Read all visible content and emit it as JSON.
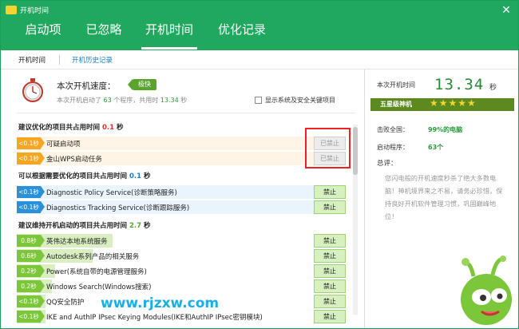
{
  "window": {
    "title": "开机时间",
    "close": "✕"
  },
  "tabs": [
    "启动项",
    "已忽略",
    "开机时间",
    "优化记录"
  ],
  "subnav": {
    "current": "开机时间",
    "history": "开机历史记录"
  },
  "speed": {
    "label": "本次开机速度：",
    "badge": "极快",
    "detail_pre": "本次开机启动了",
    "program_count": "63",
    "detail_mid": "个程序，共用时",
    "time": "13.34",
    "detail_post": "秒"
  },
  "show_system": {
    "label": "显示系统及安全关键项目"
  },
  "sections": [
    {
      "title": "建议优化的项目共占用时间",
      "value": "0.1",
      "unit": "秒"
    },
    {
      "title": "可以根据需要优化的项目共占用时间",
      "value": "0.1",
      "unit": "秒"
    },
    {
      "title": "建议维持开机启动的项目共占用时间",
      "value": "2.7",
      "unit": "秒"
    }
  ],
  "rows_optimize": [
    {
      "badge": "<0.1秒",
      "name": "可疑启动项",
      "button": "已禁止"
    },
    {
      "badge": "<0.1秒",
      "name": "金山WPS启动任务",
      "button": "已禁止"
    }
  ],
  "rows_optional": [
    {
      "badge": "<0.1秒",
      "name": "Diagnostic Policy Service(诊断策略服务)",
      "button": "禁止"
    },
    {
      "badge": "<0.1秒",
      "name": "Diagnostics Tracking Service(诊断跟踪服务)",
      "button": "禁止"
    }
  ],
  "rows_keep": [
    {
      "badge": "0.8秒",
      "name": "英伟达本地系统服务",
      "button": "禁止"
    },
    {
      "badge": "0.6秒",
      "name": "Autodesk系列产品的相关服务",
      "button": "禁止"
    },
    {
      "badge": "0.2秒",
      "name": "Power(系统自带的电源管理服务)",
      "button": "禁止"
    },
    {
      "badge": "0.2秒",
      "name": "Windows Search(Windows搜索)",
      "button": "禁止"
    },
    {
      "badge": "<0.1秒",
      "name": "QQ安全防护",
      "button": "禁止"
    },
    {
      "badge": "<0.1秒",
      "name": "IKE and AuthIP IPsec Keying Modules(IKE和AuthIP IPsec密钥模块)",
      "button": "禁止"
    }
  ],
  "right": {
    "boot_time_label": "本次开机时间",
    "boot_time": "13.34",
    "boot_time_unit": "秒",
    "rank": "五星级神机",
    "stars": "★★★★★",
    "beat_label": "击败全国：",
    "beat_value": "99%的电脑",
    "programs_label": "启动程序：",
    "programs_value": "63个",
    "summary_label": "总评：",
    "summary_text": "您闪电般的开机速度秒杀了绝大多数电脑！神机境界来之不易，请务必珍惜，保持良好开机软件管理习惯，巩固巅峰地位！"
  },
  "watermark": "www.rjzxw.com",
  "colors": {
    "brand": "#1fa85e",
    "badge_orange": "#f5a623",
    "badge_blue": "#2a90d8",
    "badge_green": "#7cc63a",
    "highlight_red": "#e22"
  }
}
